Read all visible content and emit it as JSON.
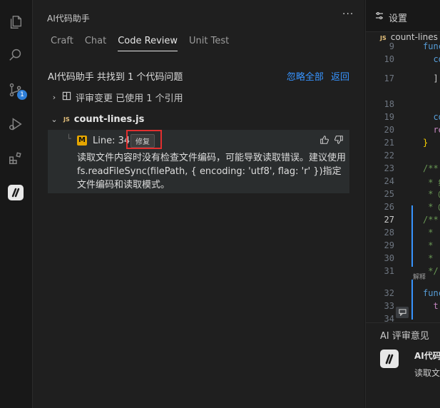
{
  "activity": {
    "badge": "1"
  },
  "panel": {
    "title": "AI代码助手",
    "more": "···",
    "tabs": [
      {
        "label": "Craft"
      },
      {
        "label": "Chat"
      },
      {
        "label": "Code Review"
      },
      {
        "label": "Unit Test"
      }
    ],
    "summary": "AI代码助手 共找到 1 个代码问题",
    "actions": {
      "ignore_all": "忽略全部",
      "back": "返回"
    },
    "review_change": "评审变更 已使用 1 个引用",
    "file": {
      "name": "count-lines.js",
      "tag": "JS"
    },
    "issue": {
      "severity": "M",
      "line": "Line: 34",
      "fix": "修复",
      "text": "读取文件内容时没有检查文件编码，可能导致读取错误。建议使用 fs.readFileSync(filePath, { encoding: 'utf8', flag: 'r' })指定文件编码和读取模式。"
    }
  },
  "editor": {
    "settings_tab": "设置",
    "breadcrumb": "count-lines",
    "breadcrumb_tag": "JS",
    "lines": [
      {
        "n": "9",
        "code": "func",
        "color": "#569cd6"
      },
      {
        "n": "10",
        "code": "  co",
        "color": "#569cd6"
      },
      {
        "n": "17",
        "code": "  ];",
        "color": "#cccccc"
      },
      {
        "n": "18",
        "code": "",
        "color": "#cccccc"
      },
      {
        "n": "19",
        "code": "  co",
        "color": "#569cd6"
      },
      {
        "n": "20",
        "code": "  re",
        "color": "#c586c0"
      },
      {
        "n": "21",
        "code": "}",
        "color": "#ffd700"
      },
      {
        "n": "22",
        "code": "",
        "color": "#cccccc"
      },
      {
        "n": "23",
        "code": "/**",
        "color": "#6a9955"
      },
      {
        "n": "24",
        "code": " * 统",
        "color": "#6a9955"
      },
      {
        "n": "25",
        "code": " * @",
        "color": "#6a9955"
      },
      {
        "n": "26",
        "code": " * @",
        "color": "#6a9955"
      },
      {
        "n": "27",
        "code": "/**",
        "color": "#6a9955"
      },
      {
        "n": "28",
        "code": " *",
        "color": "#6a9955"
      },
      {
        "n": "29",
        "code": " *",
        "color": "#6a9955"
      },
      {
        "n": "30",
        "code": " *",
        "color": "#6a9955"
      },
      {
        "n": "31",
        "code": " */",
        "color": "#6a9955"
      },
      {
        "n": "32",
        "code": "func",
        "color": "#569cd6"
      },
      {
        "n": "33",
        "code": "  t",
        "color": "#c586c0"
      },
      {
        "n": "34",
        "code": "",
        "color": "#cccccc"
      }
    ],
    "codelens": "解释",
    "review_title": "AI 评审意见",
    "review_name": "AI代码",
    "review_text": "读取文"
  }
}
